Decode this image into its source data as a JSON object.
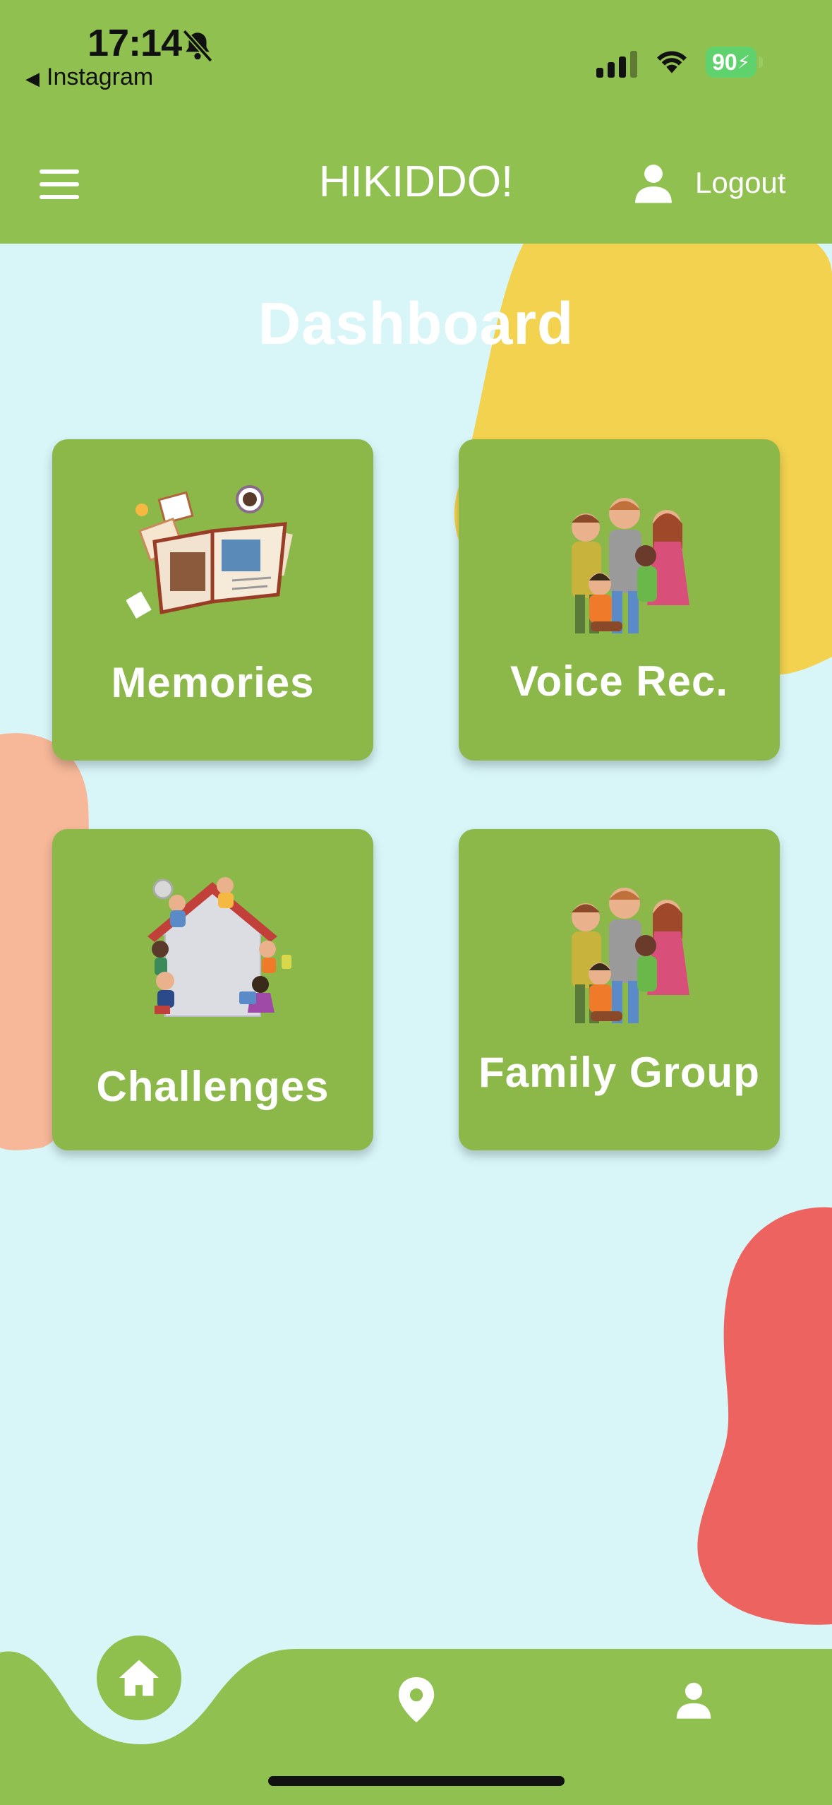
{
  "status_bar": {
    "time": "17:14",
    "back_app": "Instagram",
    "battery": "90",
    "icons": [
      "bell-muted-icon",
      "signal-icon",
      "wifi-icon",
      "battery-charging-icon"
    ]
  },
  "app_bar": {
    "title": "HIKIDDO!",
    "logout_label": "Logout",
    "icons": [
      "menu-icon",
      "person-icon"
    ]
  },
  "dashboard": {
    "title": "Dashboard",
    "tiles": [
      {
        "label": "Memories",
        "icon": "photo-album-illustration"
      },
      {
        "label": "Voice Rec.",
        "icon": "family-illustration"
      },
      {
        "label": "Challenges",
        "icon": "house-kids-illustration"
      },
      {
        "label": "Family Group",
        "icon": "family-illustration"
      }
    ]
  },
  "bottom_nav": {
    "items": [
      "home-icon",
      "location-pin-icon",
      "person-icon"
    ],
    "active": "home-icon"
  },
  "colors": {
    "primary_green": "#90c04f",
    "tile_green": "#8cb84a",
    "background": "#d8f6f8",
    "blob_yellow": "#f2d24e",
    "blob_peach": "#f6b898",
    "blob_red": "#ec635f"
  }
}
